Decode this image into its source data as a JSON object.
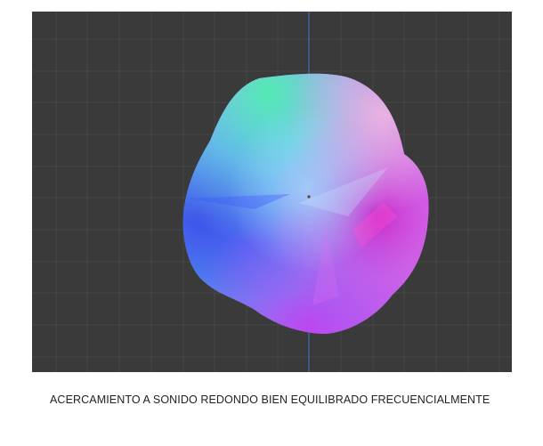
{
  "caption": "ACERCAMIENTO A SONIDO REDONDO BIEN EQUILIBRADO FRECUENCIALMENTE",
  "viewport": {
    "background": "#3a3a3a",
    "grid_color": "#4a4a4a",
    "axis_color": "#3d6fb0"
  }
}
